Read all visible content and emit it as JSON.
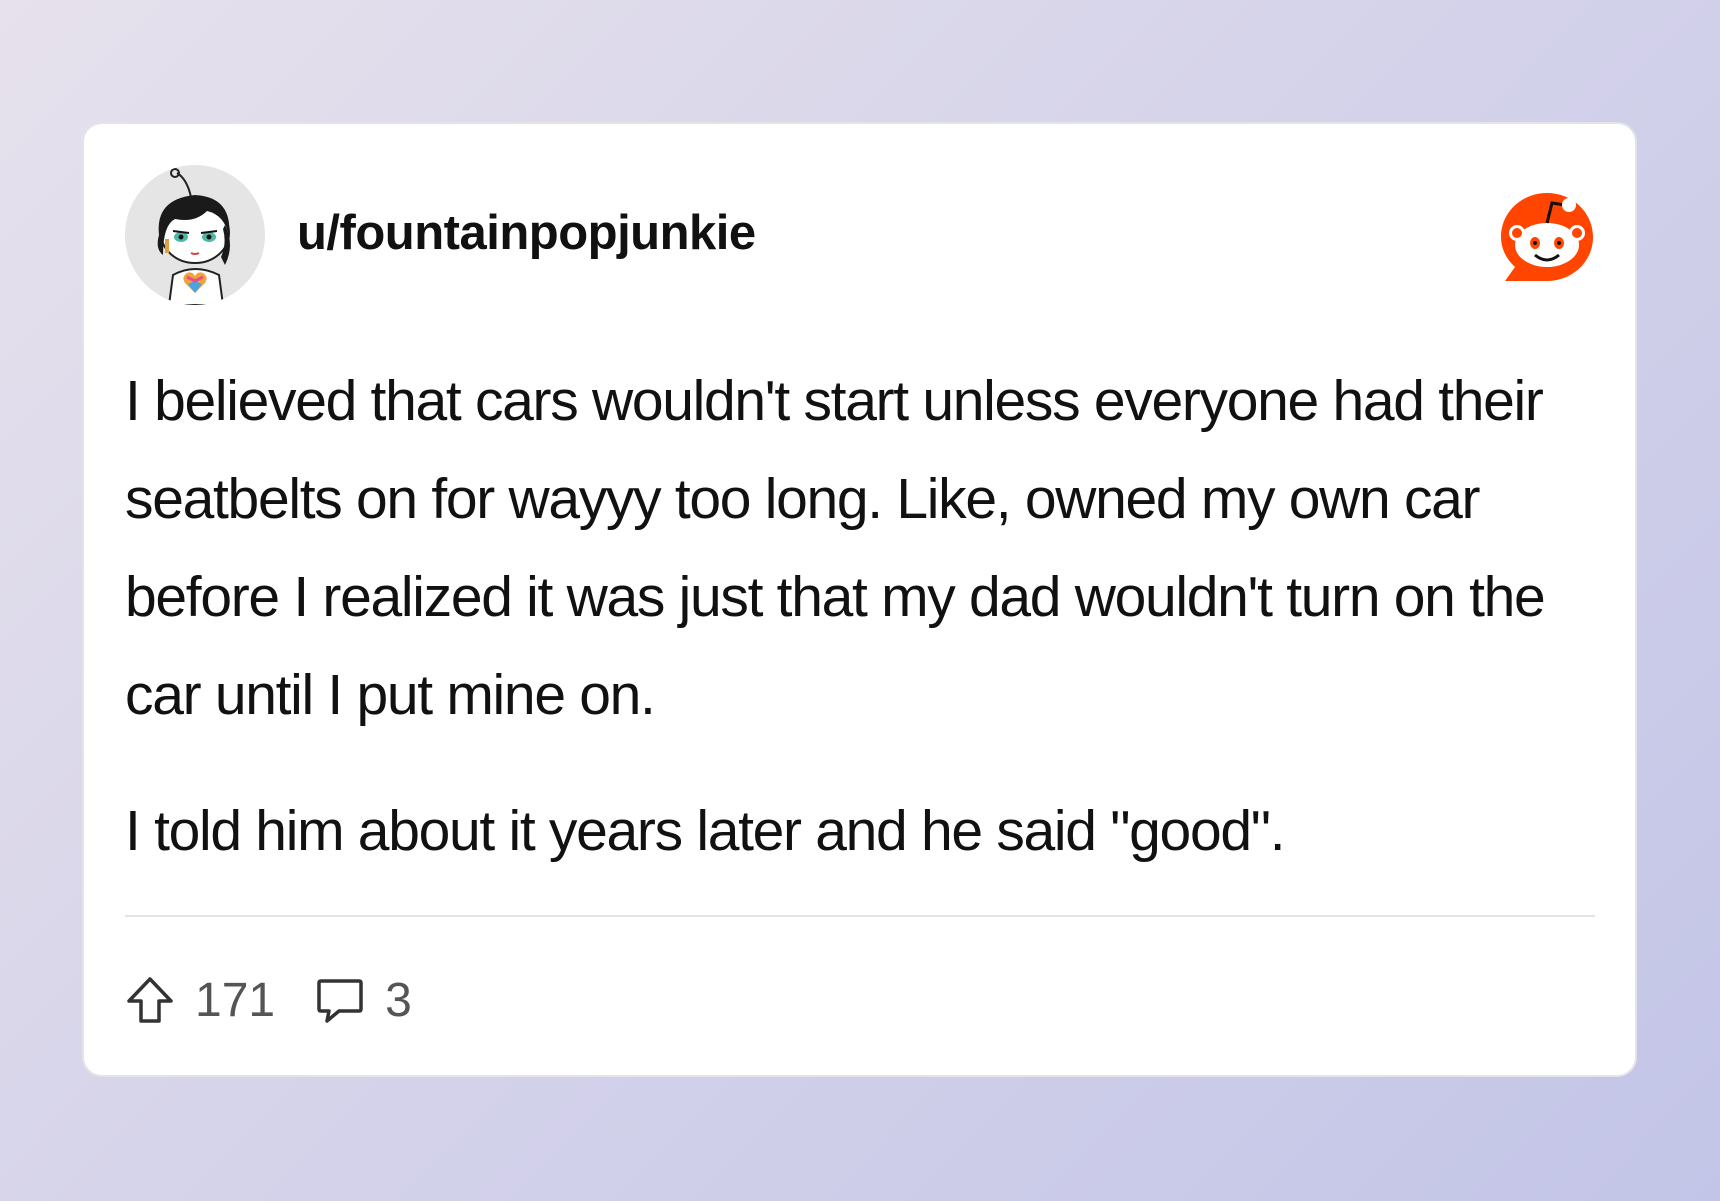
{
  "post": {
    "username": "u/fountainpopjunkie",
    "paragraphs": [
      "I believed that cars wouldn't start unless everyone had their seatbelts on for wayyy too long. Like, owned my own car before I realized it was just that my dad wouldn't turn on the car until I put mine on.",
      "I told him about it years later and he said \"good\"."
    ],
    "upvotes": "171",
    "comments": "3"
  },
  "icons": {
    "avatar": "snoo-avatar",
    "brand": "reddit-logo-icon",
    "upvote": "upvote-arrow-icon",
    "comment": "comment-bubble-icon"
  },
  "colors": {
    "brand": "#FF4500",
    "text": "#111111",
    "muted": "#555555",
    "card": "#FFFFFF"
  }
}
